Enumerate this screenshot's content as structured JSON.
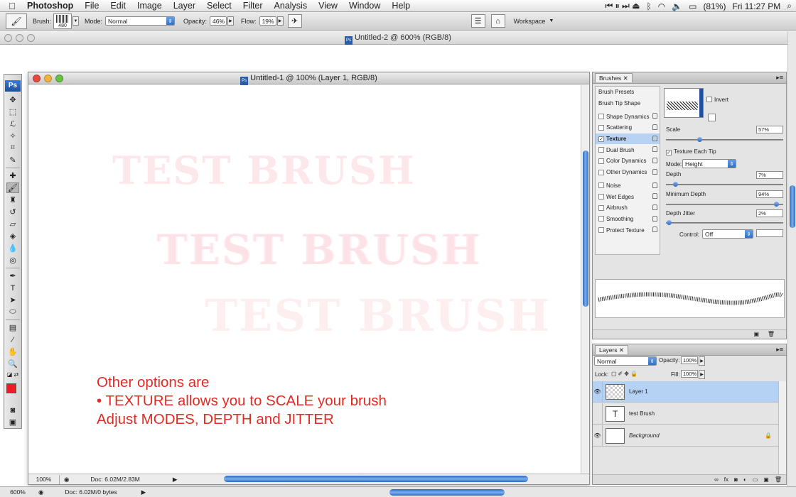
{
  "menubar": {
    "app": "Photoshop",
    "items": [
      "File",
      "Edit",
      "Image",
      "Layer",
      "Select",
      "Filter",
      "Analysis",
      "View",
      "Window",
      "Help"
    ],
    "battery": "(81%)",
    "clock": "Fri 11:27 PM"
  },
  "options": {
    "brush_label": "Brush:",
    "brush_size": "480",
    "mode_label": "Mode:",
    "mode_value": "Normal",
    "opacity_label": "Opacity:",
    "opacity_value": "46%",
    "flow_label": "Flow:",
    "flow_value": "19%",
    "workspace_label": "Workspace"
  },
  "background_doc": {
    "title": "Untitled-2 @ 600% (RGB/8)",
    "zoom": "600%",
    "doc_info": "Doc: 6.02M/0 bytes"
  },
  "document": {
    "title": "Untitled-1 @ 100% (Layer 1, RGB/8)",
    "zoom": "100%",
    "doc_info": "Doc: 6.02M/2.83M",
    "canvas_texts": [
      "TEST BRUSH",
      "TEST BRUSH",
      "TEST BRUSH"
    ],
    "annotation": [
      "Other options are",
      "• TEXTURE allows you to SCALE your brush",
      "Adjust MODES, DEPTH and JITTER"
    ]
  },
  "brushes_panel": {
    "tab": "Brushes",
    "list": [
      {
        "label": "Brush Presets",
        "checkbox": false,
        "lock": false,
        "checked": false
      },
      {
        "label": "Brush Tip Shape",
        "checkbox": false,
        "lock": false,
        "checked": false
      },
      {
        "label": "Shape Dynamics",
        "checkbox": true,
        "lock": true,
        "checked": false
      },
      {
        "label": "Scattering",
        "checkbox": true,
        "lock": true,
        "checked": false
      },
      {
        "label": "Texture",
        "checkbox": true,
        "lock": true,
        "checked": true
      },
      {
        "label": "Dual Brush",
        "checkbox": true,
        "lock": true,
        "checked": false
      },
      {
        "label": "Color Dynamics",
        "checkbox": true,
        "lock": true,
        "checked": false
      },
      {
        "label": "Other Dynamics",
        "checkbox": true,
        "lock": true,
        "checked": false
      },
      {
        "label": "Noise",
        "checkbox": true,
        "lock": true,
        "checked": false
      },
      {
        "label": "Wet Edges",
        "checkbox": true,
        "lock": true,
        "checked": false
      },
      {
        "label": "Airbrush",
        "checkbox": true,
        "lock": true,
        "checked": false
      },
      {
        "label": "Smoothing",
        "checkbox": true,
        "lock": true,
        "checked": false
      },
      {
        "label": "Protect Texture",
        "checkbox": true,
        "lock": true,
        "checked": false
      }
    ],
    "invert_label": "Invert",
    "scale_label": "Scale",
    "scale_value": "57%",
    "texture_each_tip_label": "Texture Each Tip",
    "mode_label": "Mode:",
    "mode_value": "Height",
    "depth_label": "Depth",
    "depth_value": "7%",
    "min_depth_label": "Minimum Depth",
    "min_depth_value": "94%",
    "depth_jitter_label": "Depth Jitter",
    "depth_jitter_value": "2%",
    "control_label": "Control:",
    "control_value": "Off"
  },
  "layers_panel": {
    "tab": "Layers",
    "blend_mode": "Normal",
    "opacity_label": "Opacity:",
    "opacity_value": "100%",
    "lock_label": "Lock:",
    "fill_label": "Fill:",
    "fill_value": "100%",
    "layers": [
      {
        "name": "Layer 1",
        "visible": true,
        "selected": true
      },
      {
        "name": "test Brush",
        "visible": false,
        "selected": false
      },
      {
        "name": "Background",
        "visible": true,
        "selected": false
      }
    ]
  },
  "colors": {
    "accent": "#2f6cc4",
    "annotation": "#e32b24",
    "foreground_swatch": "#ee1c25"
  }
}
